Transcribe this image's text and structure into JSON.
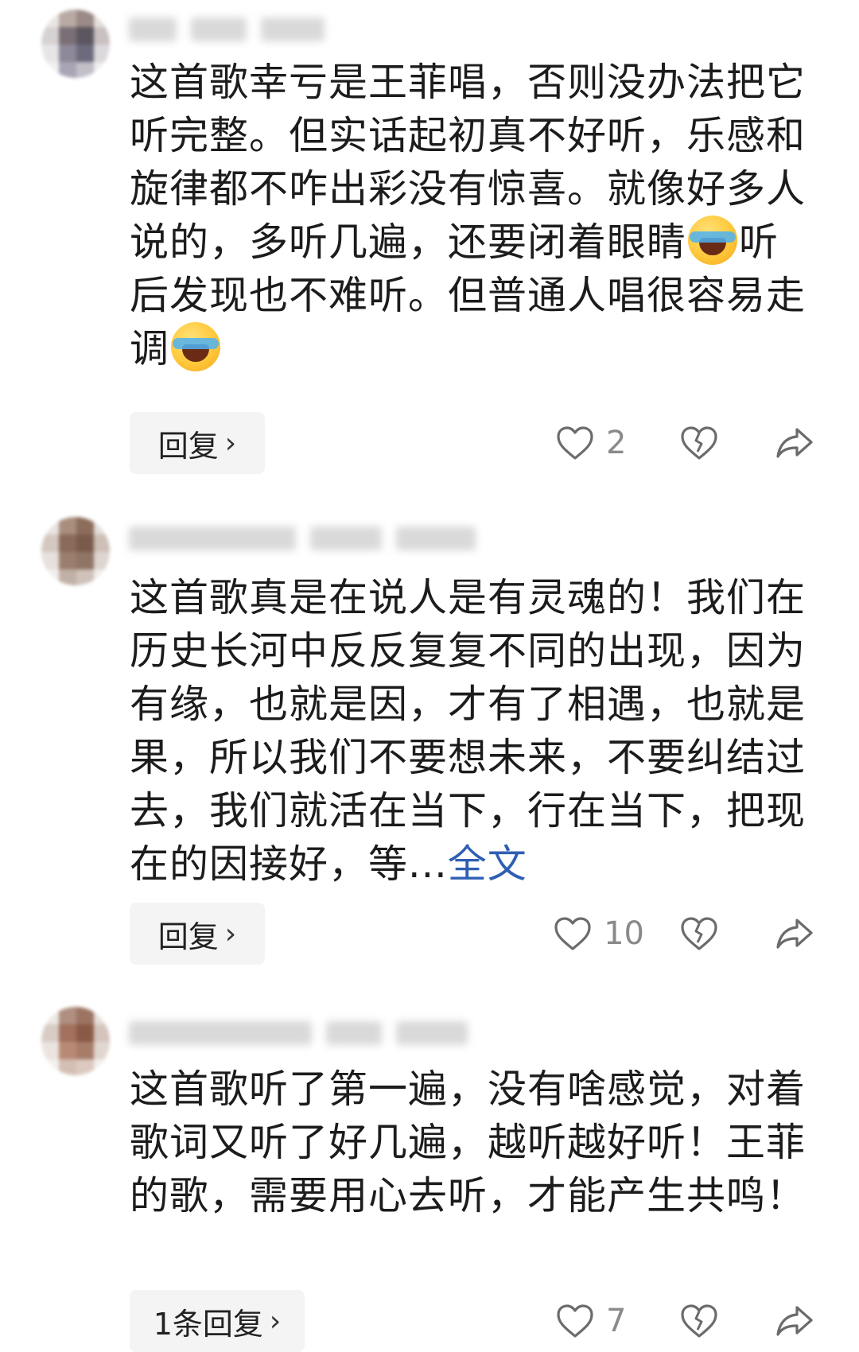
{
  "comments": [
    {
      "text_before_emoji1": "这首歌幸亏是王菲唱，否则没办法把它听完整。但实话起初真不好听，乐感和旋律都不咋出彩没有惊喜。就像好多人说的，多听几遍，还要闭着眼睛",
      "text_between_emojis": "听后发现也不难听。但普通人唱很容易走调",
      "emoji_icon": "laughing-crying-emoji",
      "reply_label": "回复",
      "like_count": "2"
    },
    {
      "text": "这首歌真是在说人是有灵魂的！我们在历史长河中反反复复不同的出现，因为有缘，也就是因，才有了相遇，也就是果，所以我们不要想未来，不要纠结过去，我们就活在当下，行在当下，把现在的因接好，等...",
      "fulltext_label": "全文",
      "reply_label": "回复",
      "like_count": "10"
    },
    {
      "text": "这首歌听了第一遍，没有啥感觉，对着歌词又听了好几遍，越听越好听！王菲的歌，需要用心去听，才能产生共鸣！",
      "reply_label": "1条回复",
      "like_count": "7"
    }
  ],
  "icons": {
    "like": "heart-outline-icon",
    "dislike": "broken-heart-icon",
    "share": "share-arrow-icon",
    "chevron": "chevron-right-icon"
  },
  "colors": {
    "link": "#2f5fb3",
    "text": "#1c1c1c",
    "count": "#8a8a8a",
    "reply_bg": "#f4f4f4"
  }
}
